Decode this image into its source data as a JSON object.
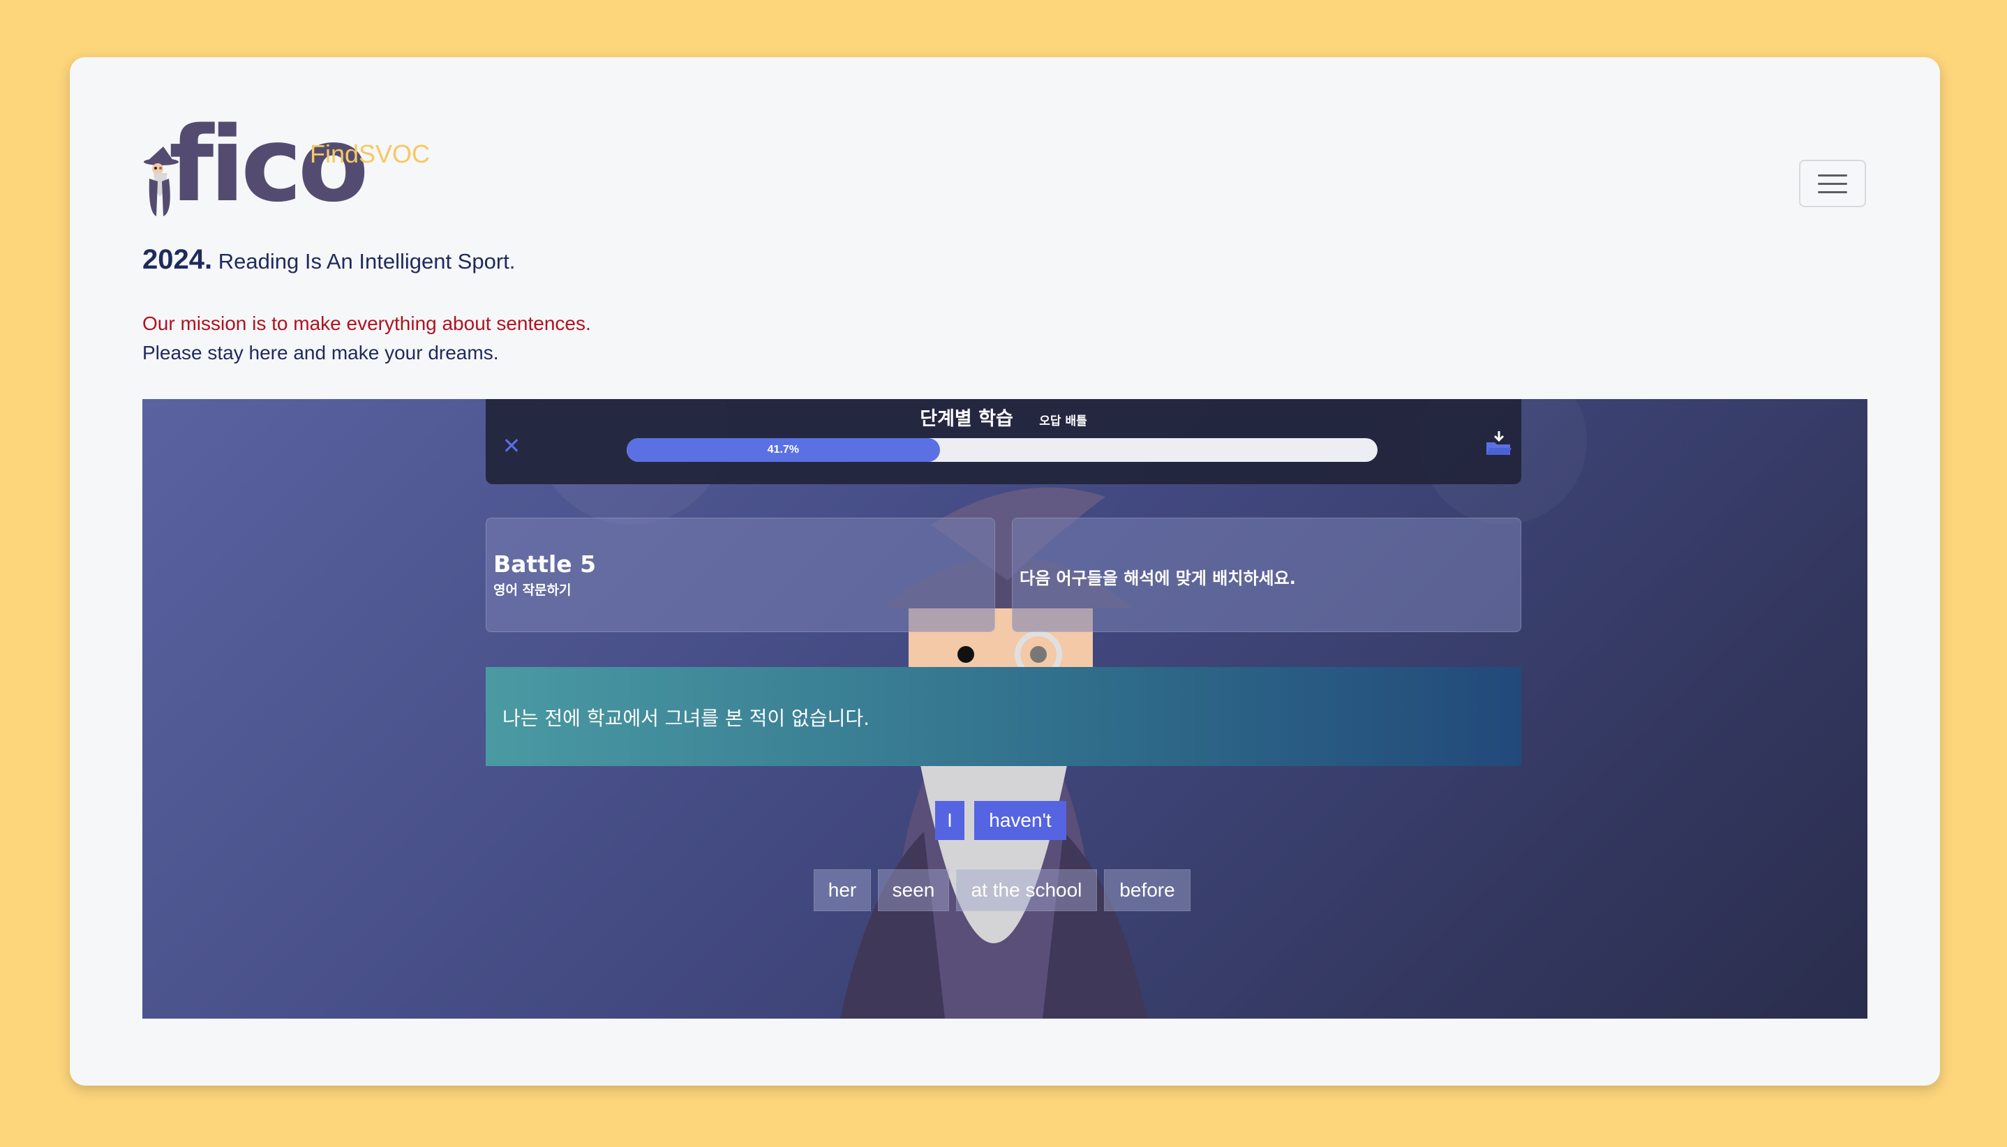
{
  "brand": {
    "logo_text": "fico",
    "sub": "FindSVOC"
  },
  "header": {
    "year": "2024.",
    "tagline": "Reading Is An Intelligent Sport.",
    "mission": "Our mission is to make everything about sentences.",
    "dreams": "Please stay here and make your dreams."
  },
  "game": {
    "title": "단계별 학습",
    "subtitle": "오답 배틀",
    "progress": {
      "label": "41.7%",
      "value": 41.7
    },
    "battle_title": "Battle 5",
    "battle_subtitle": "영어 작문하기",
    "instruction": "다음 어구들을 해석에 맞게 배치하세요.",
    "prompt": "나는 전에 학교에서 그녀를 본 적이 없습니다.",
    "placed_words": [
      "I",
      "haven't"
    ],
    "bank_words": [
      "her",
      "seen",
      "at the school",
      "before"
    ]
  },
  "colors": {
    "background": "#fdd57b",
    "accent": "#5564e0",
    "brand_sub": "#f7c860",
    "mission": "#b0121f"
  },
  "icons": {
    "menu": "hamburger-menu-icon",
    "close": "close-icon",
    "save": "folder-download-icon"
  }
}
